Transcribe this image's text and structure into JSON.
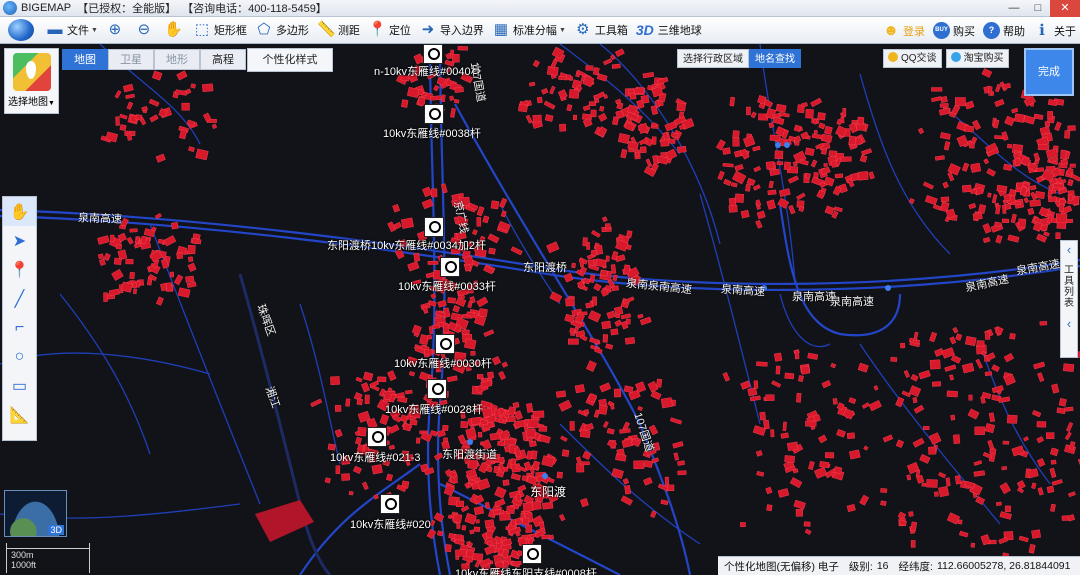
{
  "titlebar": {
    "app_name": "BIGEMAP",
    "license": "【已授权：全能版】",
    "hotline": "【咨询电话：400-118-5459】",
    "minimize": "—",
    "maximize": "□",
    "close": "✕"
  },
  "toolbar": {
    "file": "文件",
    "rect_select": "矩形框",
    "polygon": "多边形",
    "measure": "测距",
    "locate": "定位",
    "import_boundary": "导入边界",
    "tile_grid": "标准分幅",
    "toolbox": "工具箱",
    "earth3d_badge": "3D",
    "earth3d": "三维地球",
    "login": "登录",
    "buy": "购买",
    "buy_badge": "BUY",
    "help": "帮助",
    "about": "关于"
  },
  "map_controls": {
    "select_map": "选择地图",
    "map_types": [
      "地图",
      "卫星",
      "地形",
      "高程"
    ],
    "custom_style": "个性化样式",
    "region_tabs": [
      "选择行政区域",
      "地名查找"
    ],
    "qq_chat": "QQ交谈",
    "taobao": "淘宝购买",
    "done": "完成",
    "tool_list": "工具列表",
    "globe_badge": "3D"
  },
  "map_labels": {
    "poles": [
      "n-10kv东雁线#0040杆",
      "10kv东雁线#0038杆",
      "东阳渡桥10kv东雁线#0034加2杆",
      "10kv东雁线#0033杆",
      "10kv东雁线#0030杆",
      "10kv东雁线#0028杆",
      "10kv东雁线#021-3",
      "10kv东雁线#020",
      "10kv东雁线东阳支线#0008杆"
    ],
    "places": [
      "东阳渡",
      "东阳渡街道",
      "东阳渡桥"
    ],
    "roads": [
      "泉南高速",
      "泉南泉南高速",
      "泉南高速",
      "泉南高速",
      "泉南高速",
      "泉南高速",
      "泉南高速",
      "京广线",
      "107国道",
      "107国道",
      "湘江",
      "珠晖区"
    ]
  },
  "scale": {
    "line1": "300m",
    "line2": "1000ft"
  },
  "status": {
    "map_name": "个性化地图(无偏移) 电子",
    "level_label": "级别:",
    "level": "16",
    "coord_label": "经纬度:",
    "coords": "112.66005278, 26.81844091"
  },
  "colors": {
    "accent": "#2f73d6",
    "building": "#d8192b",
    "road": "#1f3fb8",
    "background": "#121318"
  }
}
